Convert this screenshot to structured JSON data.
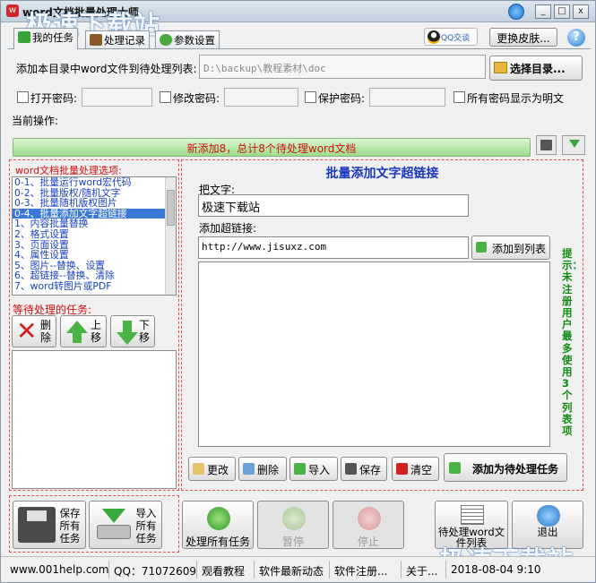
{
  "window": {
    "title": "word文档批量处理大师",
    "watermark": "极速下载站"
  },
  "tabs": [
    {
      "label": "我的任务"
    },
    {
      "label": "处理记录"
    },
    {
      "label": "参数设置"
    }
  ],
  "header": {
    "qq_badge": "QQ交谈",
    "skin_button": "更换皮肤..."
  },
  "source": {
    "label": "添加本目录中word文件到待处理列表:",
    "path": "D:\\backup\\教程素材\\doc",
    "select_button": "选择目录..."
  },
  "passwords": {
    "open_label": "打开密码:",
    "edit_label": "修改密码:",
    "protect_label": "保护密码:",
    "show_plain_label": "所有密码显示为明文"
  },
  "current_op_label": "当前操作:",
  "progress": {
    "text": "新添加8，总计8个待处理word文档",
    "fraction": 1.0
  },
  "options": {
    "title": "word文档批量处理选项:",
    "items": [
      "0-1、批量运行word宏代码",
      "0-2、批量版权/随机文字",
      "0-3、批量随机版权图片",
      "0-4、批量添加文字超链接",
      "1、内容批量替换",
      "2、格式设置",
      "3、页面设置",
      "4、属性设置",
      "5、图片--替换、设置",
      "6、超链接--替换、清除",
      "7、word转图片或PDF"
    ],
    "selected_index": 3
  },
  "pending": {
    "title": "等待处理的任务:",
    "delete_label": "删除",
    "up_label": "上移",
    "down_label": "下移"
  },
  "panel": {
    "title": "批量添加文字超链接",
    "text_label": "把文字:",
    "text_value": "极速下载站",
    "link_label": "添加超链接:",
    "link_value": "http://www.jisuxz.com",
    "add_to_list": "添加到列表",
    "side_note": "提示：未注册用户最多使用3个列表项",
    "buttons": {
      "edit": "更改",
      "delete": "删除",
      "import": "导入",
      "save": "保存",
      "clear": "清空",
      "add_pending": "添加为待处理任务"
    }
  },
  "bottom": {
    "save_all": "保存所有任务",
    "import_all": "导入所有任务",
    "run_all": "处理所有任务",
    "pause": "暂停",
    "stop": "停止",
    "pending_list": "待处理word文件列表",
    "exit": "退出"
  },
  "status": {
    "site": "www.001help.com",
    "qq": "QQ：71072609",
    "tutorial": "观看教程",
    "news": "软件最新动态",
    "register": "软件注册...",
    "about": "关于...",
    "datetime": "2018-08-04  9:10"
  },
  "colors": {
    "accent_red": "#d01010",
    "list_blue": "#1a3fc8",
    "selection": "#3a78d6",
    "progress_green": "#9bdc8b",
    "note_green": "#108a10"
  }
}
